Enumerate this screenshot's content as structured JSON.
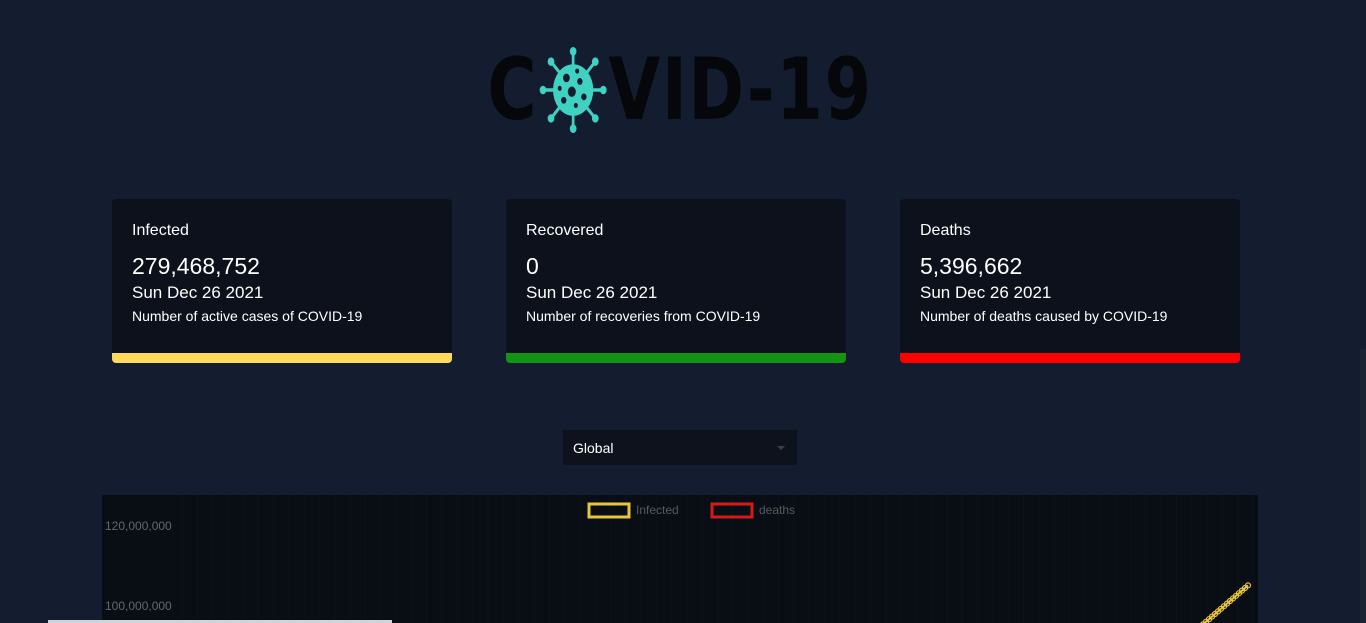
{
  "header": {
    "logo_text_before": "C",
    "logo_text_after": "VID-19",
    "logo_icon": "virus-icon"
  },
  "cards": [
    {
      "title": "Infected",
      "value": "279,468,752",
      "date": "Sun Dec 26 2021",
      "description": "Number of active cases of COVID-19",
      "color": "#ffd95a"
    },
    {
      "title": "Recovered",
      "value": "0",
      "date": "Sun Dec 26 2021",
      "description": "Number of recoveries from COVID-19",
      "color": "#149414"
    },
    {
      "title": "Deaths",
      "value": "5,396,662",
      "date": "Sun Dec 26 2021",
      "description": "Number of deaths caused by COVID-19",
      "color": "#ff0000"
    }
  ],
  "country_select": {
    "selected": "Global"
  },
  "chart_data": {
    "type": "line",
    "series": [
      {
        "name": "Infected",
        "color": "#e8c53a"
      },
      {
        "name": "deaths",
        "color": "#d61a1a"
      }
    ],
    "y_ticks": [
      "120,000,000",
      "100,000,000"
    ],
    "y_tick_values": [
      120000000,
      100000000
    ],
    "legend_position": "top"
  }
}
